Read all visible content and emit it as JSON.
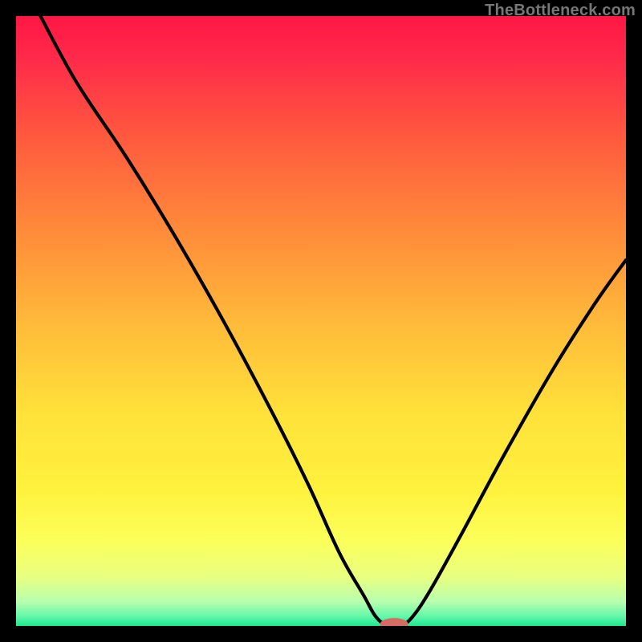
{
  "watermark": "TheBottleneck.com",
  "colors": {
    "frame": "#000000",
    "curve": "#000000",
    "marker_fill": "#d76a63",
    "gradient_stops": [
      {
        "offset": 0.0,
        "color": "#ff1744"
      },
      {
        "offset": 0.07,
        "color": "#ff2a4a"
      },
      {
        "offset": 0.2,
        "color": "#ff5a3e"
      },
      {
        "offset": 0.35,
        "color": "#ff8a3a"
      },
      {
        "offset": 0.5,
        "color": "#ffb93a"
      },
      {
        "offset": 0.65,
        "color": "#ffe13a"
      },
      {
        "offset": 0.78,
        "color": "#fff23e"
      },
      {
        "offset": 0.86,
        "color": "#fcff5a"
      },
      {
        "offset": 0.92,
        "color": "#e8ff80"
      },
      {
        "offset": 0.96,
        "color": "#b8ffae"
      },
      {
        "offset": 0.985,
        "color": "#60f7a8"
      },
      {
        "offset": 1.0,
        "color": "#19e98f"
      }
    ]
  },
  "chart_data": {
    "type": "line",
    "title": "",
    "xlabel": "",
    "ylabel": "",
    "xlim": [
      0,
      100
    ],
    "ylim": [
      0,
      100
    ],
    "categories": [],
    "series": [
      {
        "name": "bottleneck-curve",
        "points": [
          {
            "x": 4,
            "y": 100
          },
          {
            "x": 10,
            "y": 89
          },
          {
            "x": 18,
            "y": 77
          },
          {
            "x": 26,
            "y": 64
          },
          {
            "x": 34,
            "y": 50
          },
          {
            "x": 42,
            "y": 35
          },
          {
            "x": 48,
            "y": 23
          },
          {
            "x": 53,
            "y": 12
          },
          {
            "x": 57,
            "y": 5
          },
          {
            "x": 59,
            "y": 1.5
          },
          {
            "x": 61,
            "y": 0
          },
          {
            "x": 63,
            "y": 0
          },
          {
            "x": 65,
            "y": 1.5
          },
          {
            "x": 68,
            "y": 6
          },
          {
            "x": 73,
            "y": 15
          },
          {
            "x": 80,
            "y": 28
          },
          {
            "x": 88,
            "y": 42
          },
          {
            "x": 95,
            "y": 53
          },
          {
            "x": 100,
            "y": 60
          }
        ]
      }
    ],
    "marker": {
      "x": 62,
      "y": 0,
      "rx": 2.3,
      "ry": 1.0
    }
  }
}
